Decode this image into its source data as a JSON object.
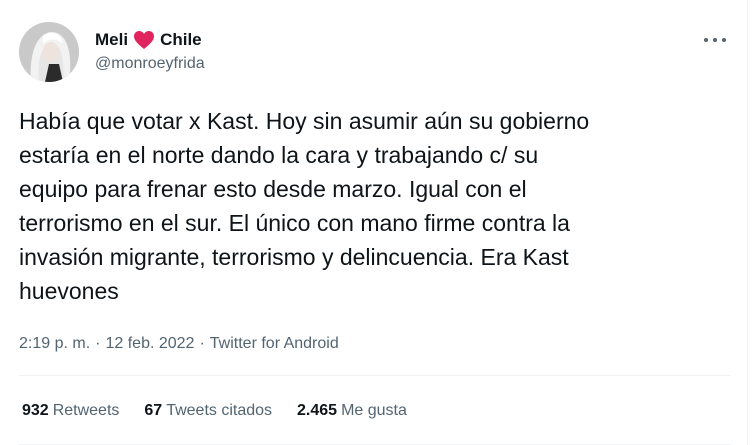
{
  "author": {
    "name_first": "Meli",
    "name_second": "Chile",
    "heart_icon": "red-heart-emoji",
    "handle": "@monroeyfrida",
    "avatar_icon": "profile-photo"
  },
  "tweet": {
    "text": "Había que votar x Kast. Hoy sin asumir aún su gobierno\nestaría en el norte dando la cara y trabajando c/ su\nequipo para frenar esto desde marzo. Igual con el\nterrorismo en el sur. El único con mano firme contra la\ninvasión migrante, terrorismo y delincuencia. Era Kast\nhuevones",
    "time": "2:19 p. m.",
    "separator": "·",
    "date": "12 feb. 2022",
    "source": "Twitter for Android"
  },
  "stats": {
    "retweets_count": "932",
    "retweets_label": "Retweets",
    "quotes_count": "67",
    "quotes_label": "Tweets citados",
    "likes_count": "2.465",
    "likes_label": "Me gusta"
  },
  "colors": {
    "text": "#0f1419",
    "secondary": "#536471",
    "heart": "#e0245e",
    "divider": "#eff3f4"
  },
  "more_icon": "more-dots-icon"
}
